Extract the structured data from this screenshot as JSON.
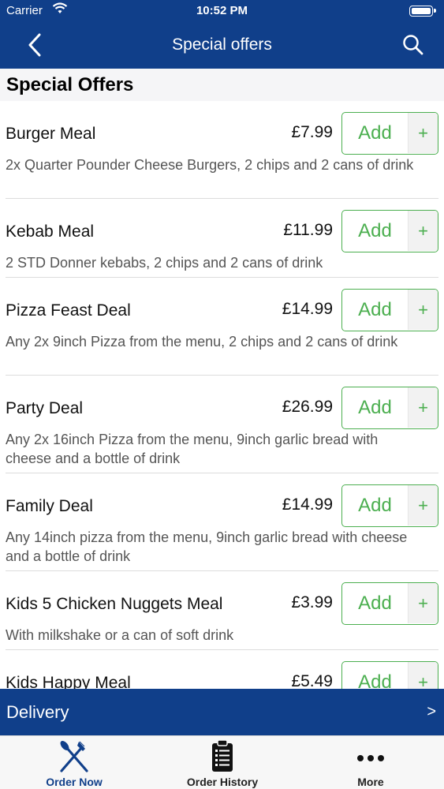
{
  "status_bar": {
    "carrier": "Carrier",
    "time": "10:52 PM"
  },
  "nav": {
    "title": "Special offers"
  },
  "section": {
    "title": "Special Offers"
  },
  "add_label": "Add",
  "add_plus": "+",
  "items": [
    {
      "name": "Burger Meal",
      "price": "£7.99",
      "desc": "2x Quarter Pounder Cheese Burgers, 2 chips and 2 cans of drink"
    },
    {
      "name": "Kebab Meal",
      "price": "£11.99",
      "desc": "2 STD Donner kebabs, 2 chips and 2 cans of drink"
    },
    {
      "name": "Pizza Feast Deal",
      "price": "£14.99",
      "desc": "Any 2x 9inch Pizza from the menu, 2 chips and 2 cans of drink"
    },
    {
      "name": "Party Deal",
      "price": "£26.99",
      "desc": "Any 2x 16inch Pizza from the menu, 9inch garlic bread with cheese and a bottle of drink"
    },
    {
      "name": "Family Deal",
      "price": "£14.99",
      "desc": "Any 14inch pizza from the menu, 9inch garlic bread with cheese and a bottle of drink"
    },
    {
      "name": "Kids 5 Chicken Nuggets Meal",
      "price": "£3.99",
      "desc": "With milkshake or a can of soft drink"
    },
    {
      "name": "Kids Happy Meal",
      "price": "£5.49",
      "desc": ""
    }
  ],
  "delivery": {
    "label": "Delivery",
    "chevron": ">"
  },
  "tabs": [
    {
      "label": "Order Now",
      "icon": "fork-knife-icon"
    },
    {
      "label": "Order History",
      "icon": "clipboard-list-icon"
    },
    {
      "label": "More",
      "icon": "more-dots-icon"
    }
  ],
  "colors": {
    "brand": "#103f8a",
    "add_green": "#4caf50"
  }
}
